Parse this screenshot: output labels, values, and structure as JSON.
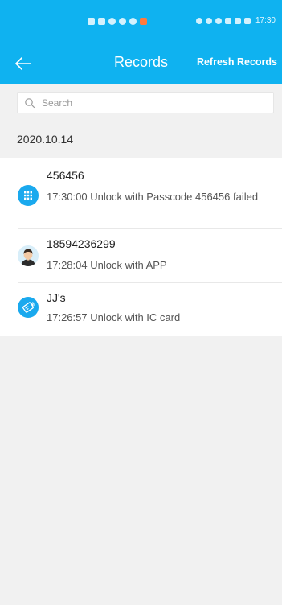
{
  "status_bar": {
    "time": "17:30"
  },
  "app_bar": {
    "title": "Records",
    "refresh_label": "Refresh Records"
  },
  "search": {
    "placeholder": "Search",
    "value": ""
  },
  "date_group": "2020.10.14",
  "records": [
    {
      "name": "456456",
      "detail": "17:30:00 Unlock with Passcode 456456 failed",
      "icon": "passcode-keypad-icon"
    },
    {
      "name": "18594236299",
      "detail": "17:28:04 Unlock with APP",
      "icon": "user-avatar"
    },
    {
      "name": "JJ's",
      "detail": "17:26:57 Unlock with IC card",
      "icon": "ic-card-icon"
    }
  ],
  "colors": {
    "accent": "#0fb2f0",
    "background": "#f1f1f1",
    "card": "#ffffff"
  }
}
